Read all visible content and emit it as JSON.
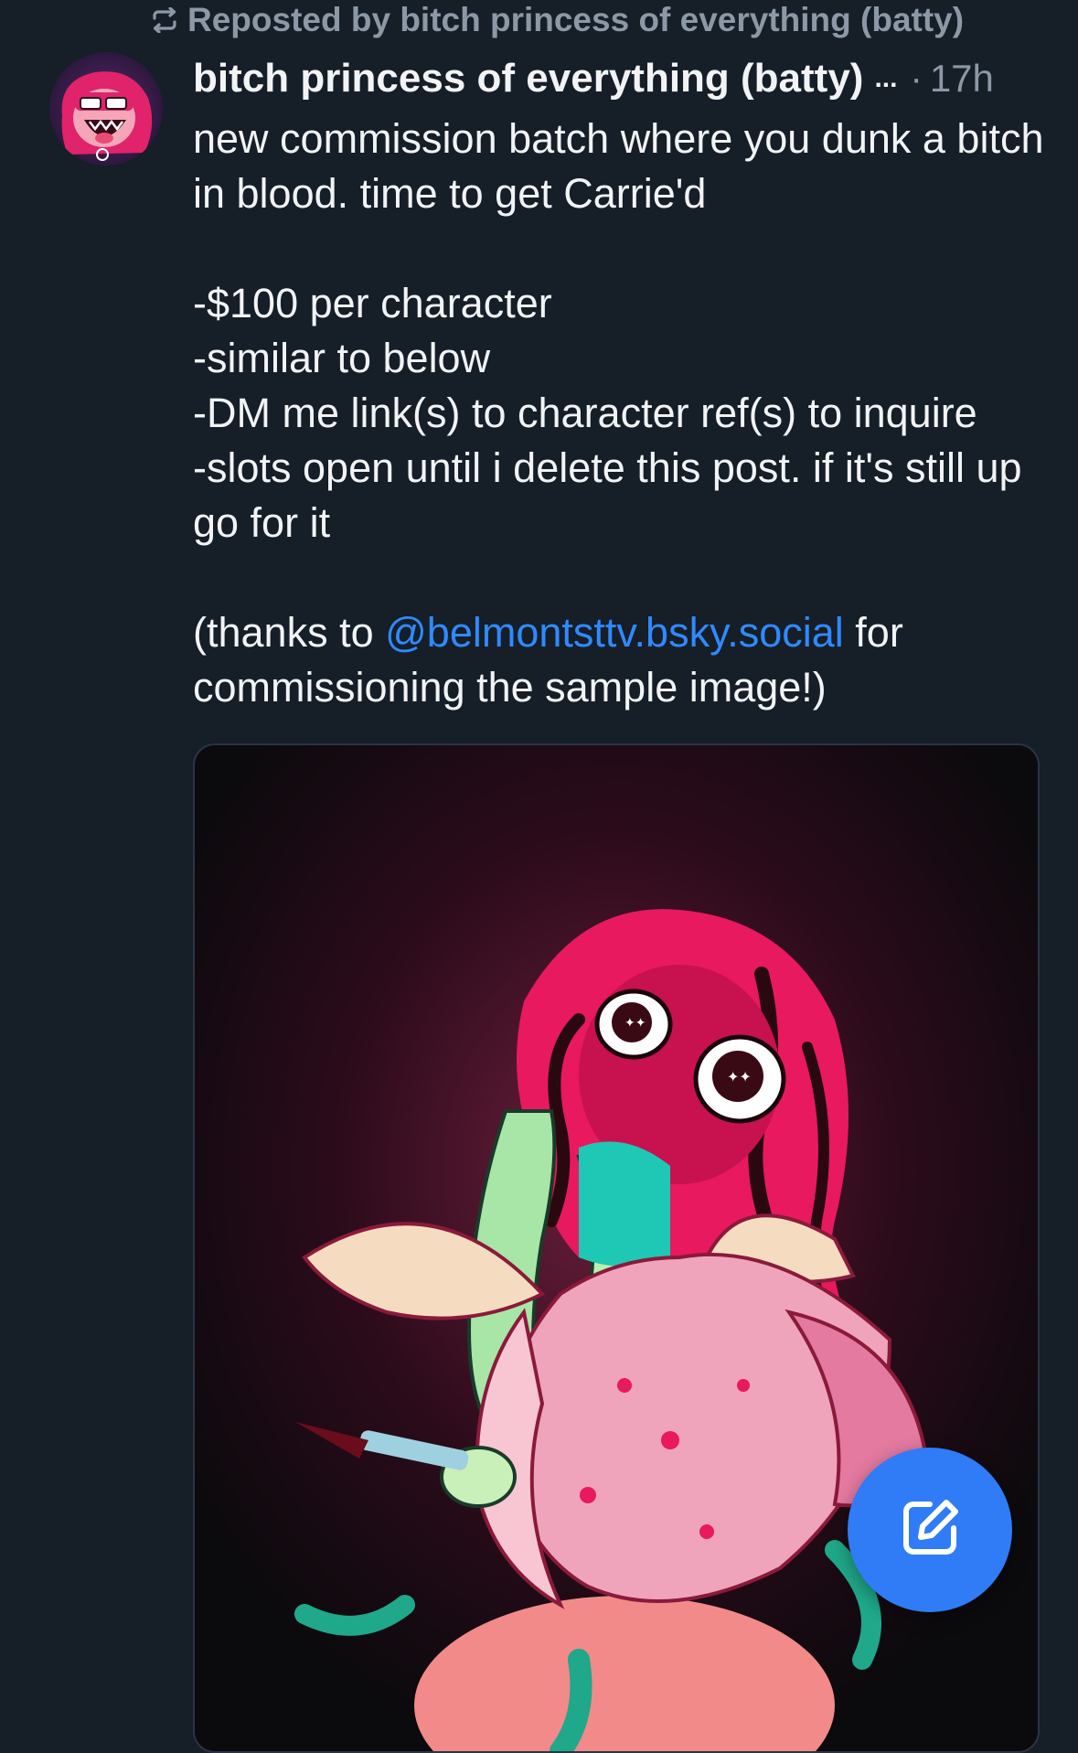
{
  "repost": {
    "icon": "repost-icon",
    "text": "Reposted by bitch princess of everything (batty)"
  },
  "post": {
    "author": {
      "display_name": "bitch princess of everything (batty)",
      "truncation": "...",
      "avatar_icon": "avatar"
    },
    "separator": "·",
    "time": "17h",
    "body": {
      "line1": "new commission batch where you dunk a bitch in blood. time to get Carrie'd",
      "item1": "-$100 per character",
      "item2": "-similar to below",
      "item3": "-DM me link(s) to character ref(s) to inquire",
      "item4": "-slots open until i delete this post. if it's still up go for it",
      "thanks_prefix": "(thanks to ",
      "mention": "@belmontsttv.bsky.social",
      "thanks_suffix": " for commissioning the sample image!)"
    },
    "image": {
      "description_icon": "post-image"
    }
  },
  "compose_button": {
    "icon": "compose-icon"
  },
  "colors": {
    "background": "#161e27",
    "text": "#f1f3f5",
    "muted": "#8c98a6",
    "link": "#2f8aff",
    "fab": "#2f7cf6"
  }
}
